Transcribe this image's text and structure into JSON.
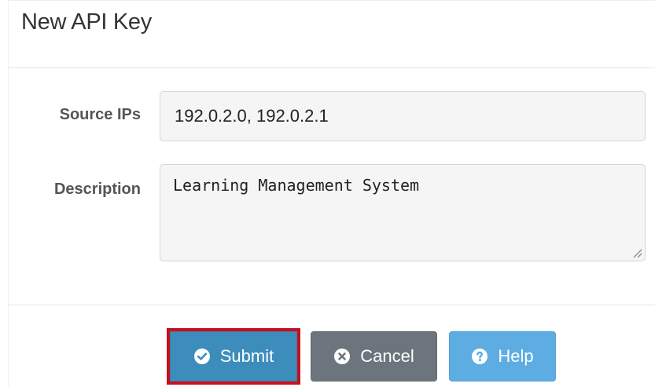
{
  "modal": {
    "title": "New API Key"
  },
  "form": {
    "source_ips": {
      "label": "Source IPs",
      "value": "192.0.2.0, 192.0.2.1"
    },
    "description": {
      "label": "Description",
      "value": "Learning Management System"
    }
  },
  "buttons": {
    "submit": {
      "label": "Submit",
      "icon": "check-circle-icon"
    },
    "cancel": {
      "label": "Cancel",
      "icon": "times-circle-icon"
    },
    "help": {
      "label": "Help",
      "icon": "question-circle-icon"
    }
  },
  "colors": {
    "submit_bg": "#3c8dbc",
    "cancel_bg": "#6c757d",
    "help_bg": "#5dade2",
    "highlight_outline": "#c8101c"
  }
}
